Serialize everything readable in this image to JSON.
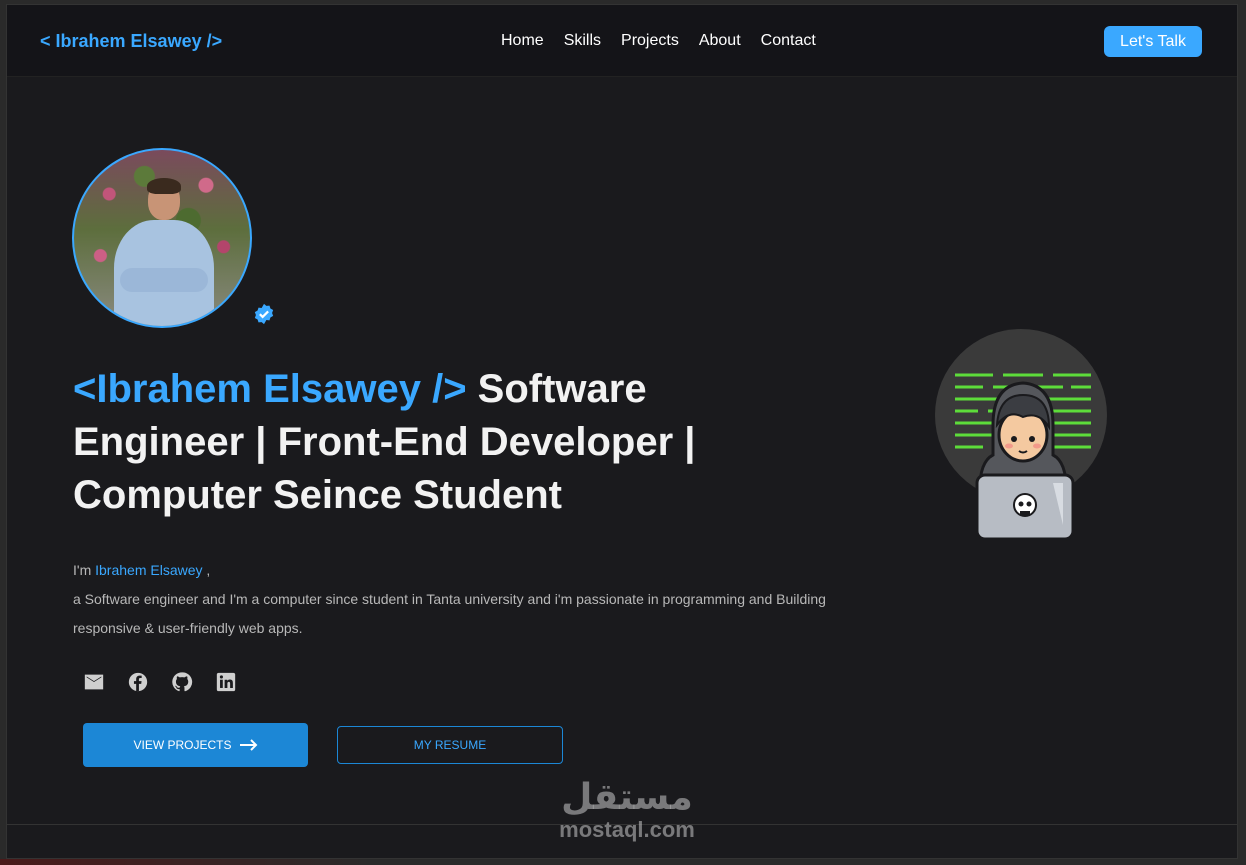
{
  "nav": {
    "brand": "< Ibrahem Elsawey />",
    "links": [
      "Home",
      "Skills",
      "Projects",
      "About",
      "Contact"
    ],
    "cta": "Let's Talk"
  },
  "hero": {
    "headline_name": "<Ibrahem Elsawey />",
    "headline_rest": " Software Engineer | Front-End Developer | Computer Seince Student",
    "intro_prefix": "I'm ",
    "intro_name": "Ibrahem Elsawey",
    "intro_suffix": " ,",
    "intro_line2": "a Software engineer and I'm a computer since student in Tanta university and i'm passionate in programming and Building",
    "intro_line3": "responsive & user-friendly web apps.",
    "socials": [
      "mail-icon",
      "facebook-icon",
      "github-icon",
      "linkedin-icon"
    ],
    "view_projects": "VIEW PROJECTS",
    "resume": "MY RESUME"
  },
  "watermark": {
    "arabic": "مستقل",
    "latin": "mostaql.com"
  },
  "colors": {
    "accent": "#3aa8ff",
    "button": "#1c87d6",
    "background": "#1a1a1d"
  }
}
